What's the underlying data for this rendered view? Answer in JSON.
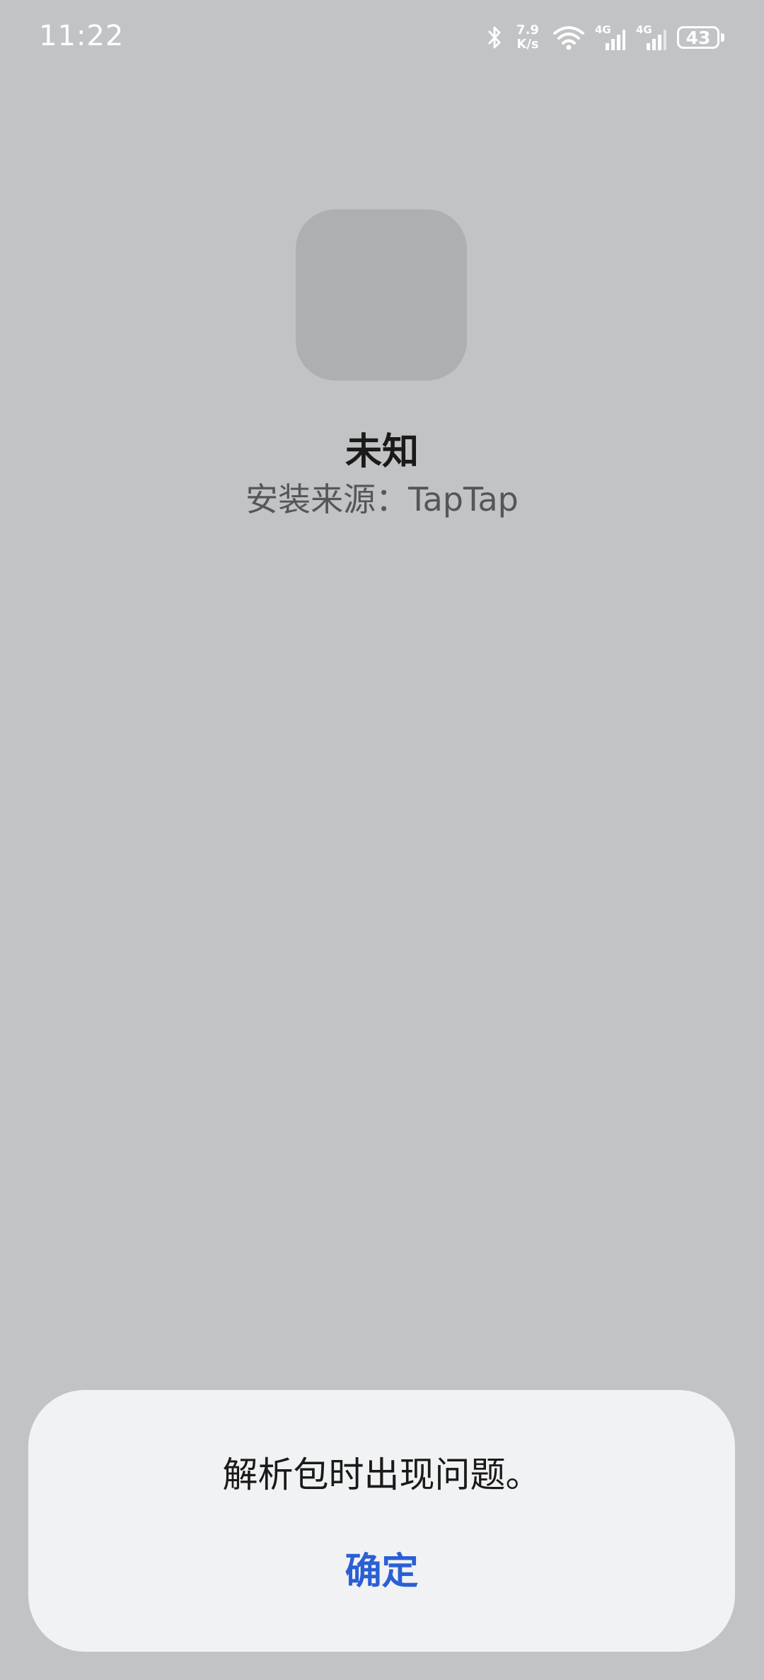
{
  "status_bar": {
    "time": "11:22",
    "net_speed_value": "7.9",
    "net_speed_unit": "K/s",
    "sim1_label": "4G",
    "sim2_label": "4G",
    "battery_level": "43",
    "icons": [
      "bluetooth-icon",
      "wifi-icon",
      "signal-icon",
      "signal-icon",
      "battery-icon"
    ]
  },
  "app": {
    "name": "未知",
    "install_source": "安装来源：TapTap"
  },
  "dialog": {
    "message": "解析包时出现问题。",
    "confirm_label": "确定"
  },
  "colors": {
    "background": "#c2c3c5",
    "dialog_background": "#f1f2f3",
    "accent": "#2a5fd6"
  }
}
